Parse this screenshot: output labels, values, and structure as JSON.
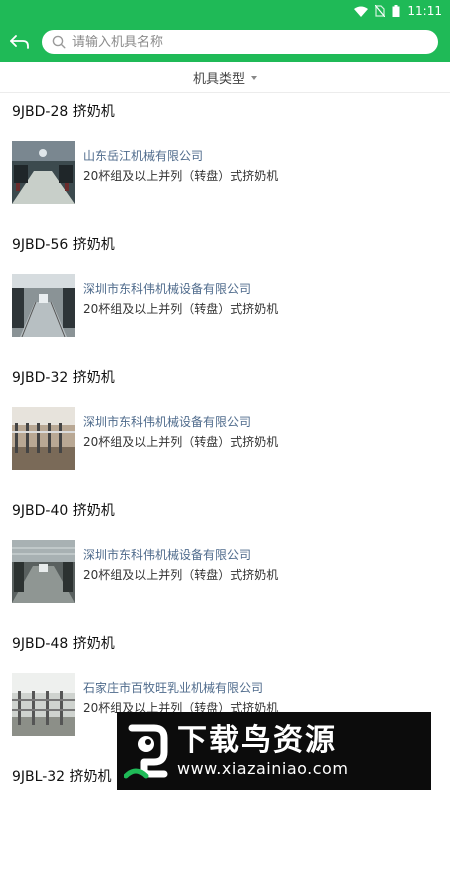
{
  "status": {
    "time": "11:11"
  },
  "header": {
    "search_placeholder": "请输入机具名称"
  },
  "filter": {
    "label": "机具类型"
  },
  "items": [
    {
      "title": "9JBD-28 挤奶机",
      "company": "山东岳江机械有限公司",
      "desc": "20杯组及以上并列（转盘）式挤奶机"
    },
    {
      "title": "9JBD-56 挤奶机",
      "company": "深圳市东科伟机械设备有限公司",
      "desc": "20杯组及以上并列（转盘）式挤奶机"
    },
    {
      "title": "9JBD-32 挤奶机",
      "company": "深圳市东科伟机械设备有限公司",
      "desc": "20杯组及以上并列（转盘）式挤奶机"
    },
    {
      "title": "9JBD-40 挤奶机",
      "company": "深圳市东科伟机械设备有限公司",
      "desc": "20杯组及以上并列（转盘）式挤奶机"
    },
    {
      "title": "9JBD-48 挤奶机",
      "company": "石家庄市百牧旺乳业机械有限公司",
      "desc": "20杯组及以上并列（转盘）式挤奶机"
    },
    {
      "title": "9JBL-32 挤奶机",
      "company": "",
      "desc": ""
    }
  ],
  "watermark": {
    "title": "下载鸟资源",
    "url": "www.xiazainiao.com"
  }
}
